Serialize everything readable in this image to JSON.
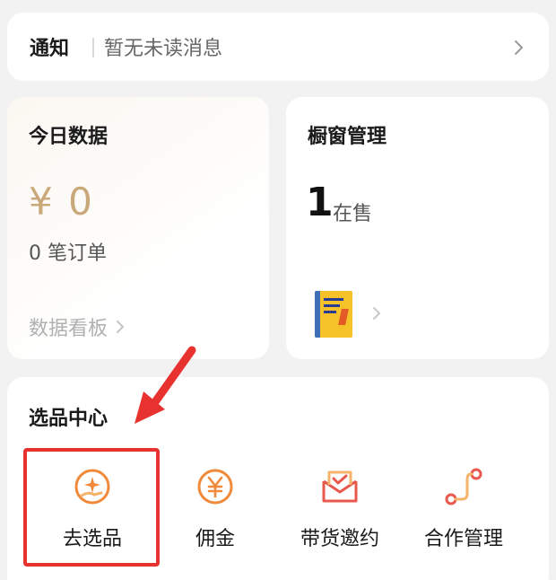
{
  "notice": {
    "title": "通知",
    "message": "暂无未读消息",
    "chevron_icon": "chevron-right-icon"
  },
  "today": {
    "title": "今日数据",
    "amount": "¥ 0",
    "orders": "0 笔订单",
    "board_link": "数据看板",
    "accent_color": "#c9a97a"
  },
  "showcase": {
    "title": "橱窗管理",
    "count": "1",
    "count_label": "在售"
  },
  "center": {
    "title": "选品中心",
    "tools": [
      {
        "label": "去选品",
        "icon": "select-product-icon"
      },
      {
        "label": "佣金",
        "icon": "yuan-coin-icon"
      },
      {
        "label": "带货邀约",
        "icon": "invitation-mail-icon"
      },
      {
        "label": "合作管理",
        "icon": "cooperation-path-icon"
      }
    ],
    "icon_color": "#f08a3a"
  },
  "annotation": {
    "highlight_color": "#e8322f"
  }
}
